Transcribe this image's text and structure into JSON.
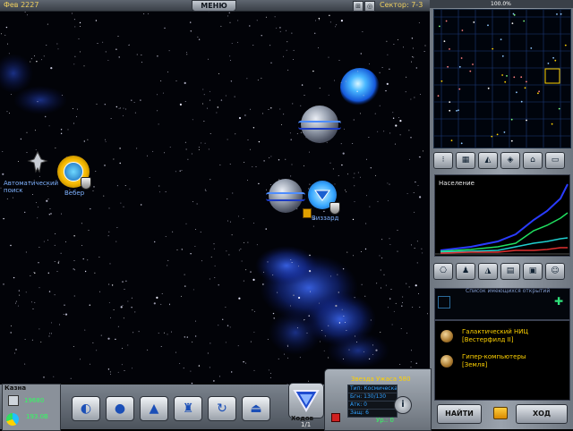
{
  "topbar": {
    "date": "Фев 2227",
    "menu_label": "МЕНЮ",
    "sector": "Сектор: 7-3"
  },
  "map": {
    "objects": [
      {
        "label": "Автоматический\nпоиск"
      },
      {
        "label": "Вебер"
      },
      {
        "label": "Виззард"
      }
    ]
  },
  "right_panel": {
    "zoom": "100.0%",
    "graph_title": "Население",
    "tech_header": "Список имеющихся открытий",
    "tech_items": [
      {
        "line1": "Галактический НИЦ",
        "line2": "[Вестерфилд II]"
      },
      {
        "line1": "Гипер-компьютеры",
        "line2": "[Земля]"
      }
    ],
    "find_label": "НАЙТИ",
    "turn_label": "ХОД"
  },
  "treasury": {
    "title": "Казна",
    "money": "19680",
    "income": "193.0B"
  },
  "ship": {
    "moves_label": "Ходов",
    "moves_value": "1/1",
    "name": "Звезда Ужаса 580",
    "type": "Тип: Космическая база",
    "hp": "Бгн: 130/130",
    "attack": "Атк: 0",
    "defense": "Защ: 6",
    "level": "Ур.: 0"
  },
  "colors": {
    "accent_yellow": "#ffd200",
    "map_label_blue": "#7fb2ff",
    "money_green": "#30ff60"
  }
}
